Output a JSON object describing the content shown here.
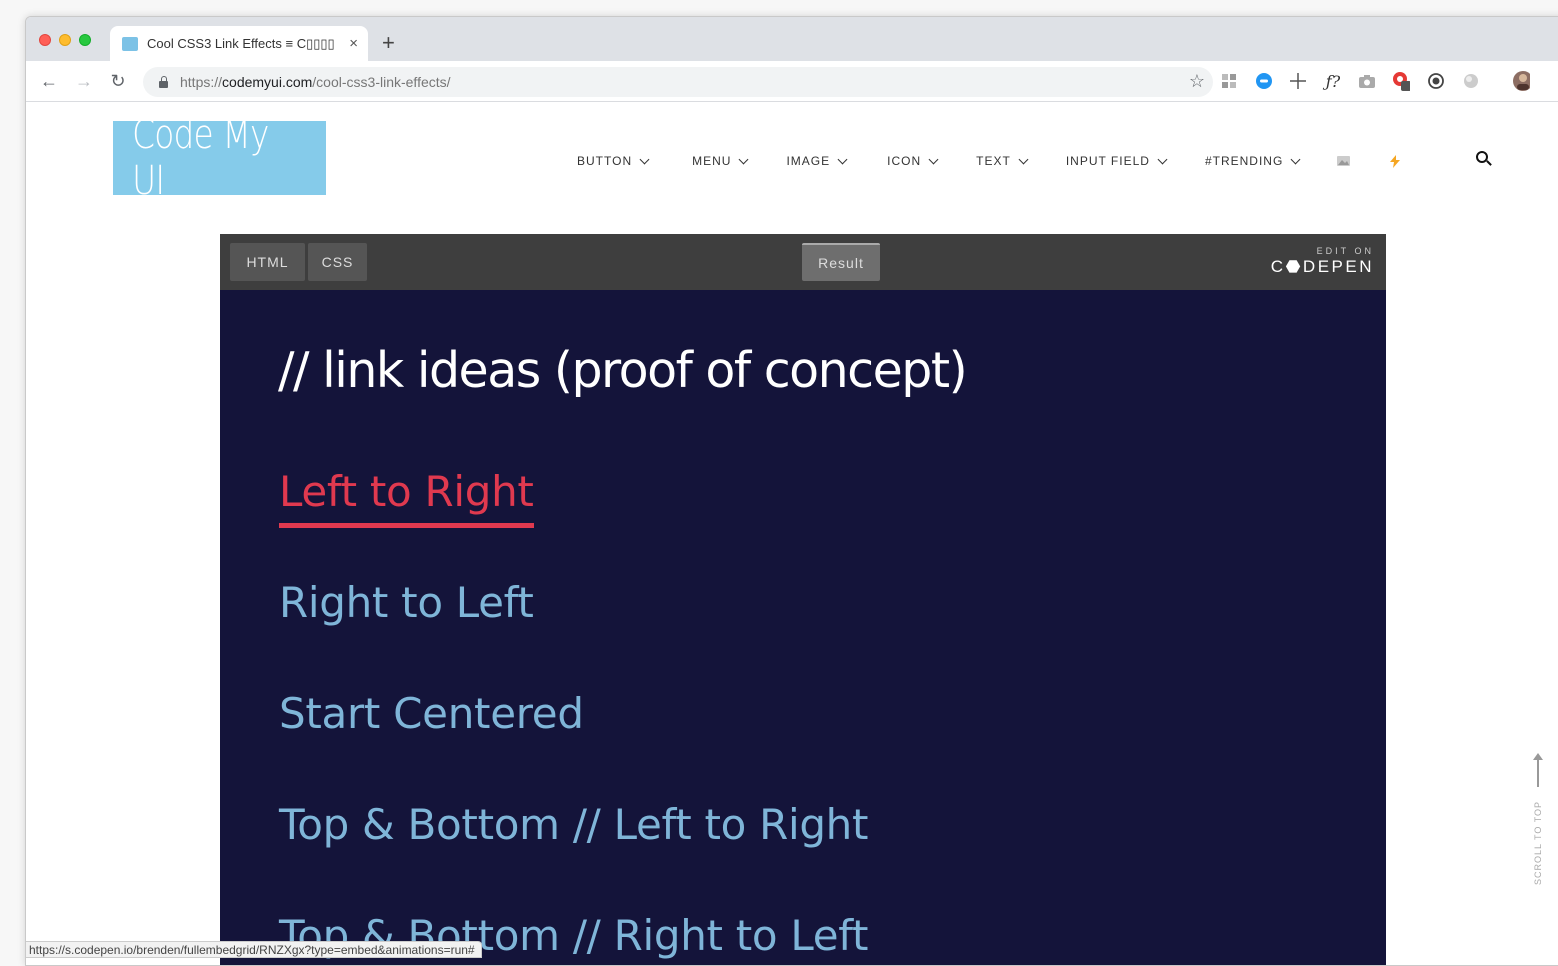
{
  "browser": {
    "tab_title": "Cool CSS3 Link Effects ≡ C▯▯▯▯",
    "tab_close": "×",
    "new_tab": "+",
    "url_prefix": "https://",
    "url_host": "codemyui.com",
    "url_path": "/cool-css3-link-effects/",
    "status_url": "https://s.codepen.io/brenden/fullembedgrid/RNZXgx?type=embed&animations=run#",
    "extensions": [
      "grid-icon",
      "blue-circle-icon",
      "move-icon",
      "function-icon",
      "camera-icon",
      "red-extension-icon",
      "record-icon",
      "grey-circle-icon",
      "profile-avatar"
    ]
  },
  "site": {
    "logo": "Code My UI",
    "nav": [
      "BUTTON",
      "MENU",
      "IMAGE",
      "ICON",
      "TEXT",
      "INPUT FIELD",
      "#TRENDING"
    ],
    "scroll_to_top": "SCROLL TO TOP"
  },
  "embed": {
    "tabs": {
      "html": "HTML",
      "css": "CSS",
      "result": "Result"
    },
    "codepen_edit": "EDIT ON",
    "codepen_brand": "C⬣DEPEN",
    "title": "// link ideas (proof of concept)",
    "links": [
      "Left to Right",
      "Right to Left",
      "Start Centered",
      "Top & Bottom // Left to Right",
      "Top & Bottom // Right to Left"
    ]
  },
  "colors": {
    "logo_bg": "#85cbea",
    "embed_bg": "#14143a",
    "link": "#7fb5d8",
    "link_active": "#e0394f"
  }
}
